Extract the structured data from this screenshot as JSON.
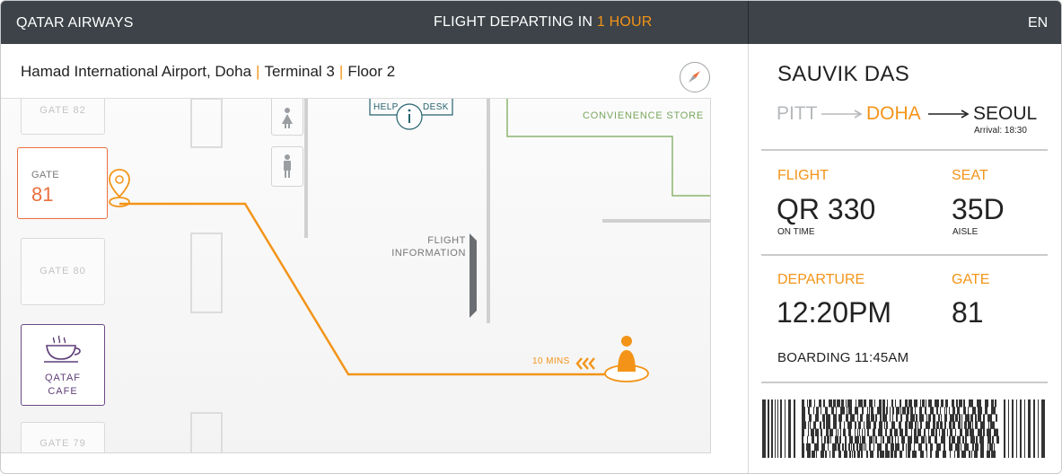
{
  "header": {
    "brand": "QATAR AIRWAYS",
    "departing_prefix": "FLIGHT DEPARTING IN",
    "departing_time": "1 HOUR",
    "language": "EN"
  },
  "location": {
    "airport": "Hamad International Airport, Doha",
    "terminal": "Terminal 3",
    "floor": "Floor 2"
  },
  "map": {
    "gates": {
      "gate82": "GATE 82",
      "gate80": "GATE 80",
      "gate79": "GATE 79",
      "current_label": "GATE",
      "current_number": "81"
    },
    "cafe": {
      "line1": "QATAF",
      "line2": "CAFE"
    },
    "help_desk": {
      "left": "HELP",
      "right": "DESK"
    },
    "convenience_store": "CONVIENENCE STORE",
    "flight_information": {
      "line1": "FLIGHT",
      "line2": "INFORMATION"
    },
    "walk_time": "10 MINS",
    "colors": {
      "route": "#f39418",
      "gate_active": "#ea6f3e",
      "cafe": "#6b4a86",
      "store": "#7aa65f",
      "help": "#26626f"
    },
    "icons": [
      "compass-icon",
      "location-pin-icon",
      "user-location-icon",
      "coffee-cup-icon",
      "restroom-icon",
      "info-icon",
      "chevrons-left-icon"
    ]
  },
  "passenger": {
    "name": "SAUVIK DAS",
    "route": {
      "from": "PITT",
      "via": "DOHA",
      "to": "SEOUL",
      "arrival": "Arrival: 18:30"
    },
    "flight": {
      "label": "FLIGHT",
      "value": "QR 330",
      "sub": "ON TIME"
    },
    "seat": {
      "label": "SEAT",
      "value": "35D",
      "sub": "AISLE"
    },
    "departure": {
      "label": "DEPARTURE",
      "value": "12:20PM"
    },
    "gate": {
      "label": "GATE",
      "value": "81"
    },
    "boarding": "BOARDING 11:45AM"
  },
  "theme": {
    "topbar": "#3d4348",
    "accent": "#f39418"
  }
}
